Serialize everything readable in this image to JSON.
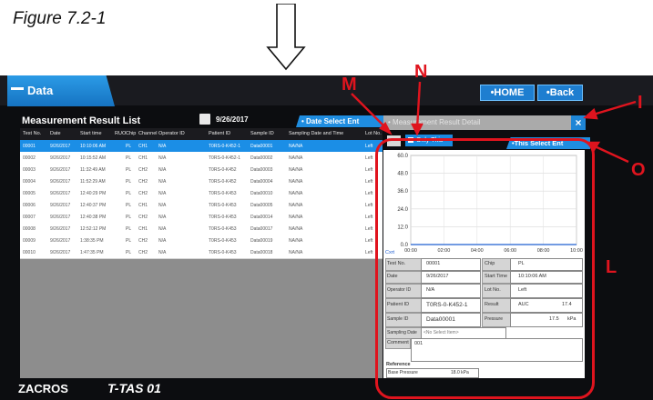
{
  "figure": {
    "caption": "Figure 7.2-1"
  },
  "callouts": {
    "m": "M",
    "n": "N",
    "i": "I",
    "o": "O",
    "l": "L"
  },
  "header": {
    "tab": "Data",
    "home": "•HOME",
    "back": "•Back"
  },
  "list": {
    "title": "Measurement Result List",
    "date": "9/26/2017",
    "date_select": "• Date Select Ent",
    "columns": [
      "Test No.",
      "Date",
      "Start time",
      "RUO",
      "Chip",
      "Channel",
      "Operator ID",
      "Patient ID",
      "Sample ID",
      "Sampling Date and Time",
      "Lot No."
    ],
    "rows": [
      [
        "00001",
        "9/26/2017",
        "10:10:06 AM",
        "",
        "PL",
        "CH1",
        "N/A",
        "T0RS-0-K452-1",
        "Data00001",
        "NA/NA",
        "Left"
      ],
      [
        "00002",
        "9/26/2017",
        "10:15:52 AM",
        "",
        "PL",
        "CH1",
        "N/A",
        "T0RS-0-K452-1",
        "Data00002",
        "NA/NA",
        "Left"
      ],
      [
        "00003",
        "9/26/2017",
        "11:32:49 AM",
        "",
        "PL",
        "CH2",
        "N/A",
        "T0RS-0-K452",
        "Data00003",
        "NA/NA",
        "Left"
      ],
      [
        "00004",
        "9/26/2017",
        "11:52:29 AM",
        "",
        "PL",
        "CH2",
        "N/A",
        "T0RS-0-K452",
        "Data00004",
        "NA/NA",
        "Left"
      ],
      [
        "00005",
        "9/26/2017",
        "12:40:29 PM",
        "",
        "PL",
        "CH2",
        "N/A",
        "T0RS-0-K453",
        "Data00010",
        "NA/NA",
        "Left"
      ],
      [
        "00006",
        "9/26/2017",
        "12:40:37 PM",
        "",
        "PL",
        "CH1",
        "N/A",
        "T0RS-0-K453",
        "Data00005",
        "NA/NA",
        "Left"
      ],
      [
        "00007",
        "9/26/2017",
        "12:40:38 PM",
        "",
        "PL",
        "CH2",
        "N/A",
        "T0RS-0-K453",
        "Data00014",
        "NA/NA",
        "Left"
      ],
      [
        "00008",
        "9/26/2017",
        "12:52:12 PM",
        "",
        "PL",
        "CH1",
        "N/A",
        "T0RS-0-K453",
        "Data00017",
        "NA/NA",
        "Left"
      ],
      [
        "00009",
        "9/26/2017",
        "1:38:35 PM",
        "",
        "PL",
        "CH2",
        "N/A",
        "T0RS-0-K453",
        "Data00019",
        "NA/NA",
        "Left"
      ],
      [
        "00010",
        "9/26/2017",
        "1:47:35 PM",
        "",
        "PL",
        "CH2",
        "N/A",
        "T0RS-0-K453",
        "Data00018",
        "NA/NA",
        "Left"
      ]
    ]
  },
  "detail": {
    "title": "• Measurement Result Detail",
    "close": "×",
    "only_this": "Only This",
    "this_select": "•This Select Ent",
    "chart_data": {
      "type": "line",
      "title": "",
      "xlabel": "",
      "ylabel": "",
      "y_ticks": [
        "60.0",
        "48.0",
        "36.0",
        "24.0",
        "12.0",
        "0.0"
      ],
      "x_ticks": [
        "00:00",
        "02:00",
        "04:00",
        "06:00",
        "08:00",
        "10:00"
      ],
      "ylim": [
        0,
        60
      ],
      "grid": true,
      "x": [
        0,
        0.2,
        0.5,
        1,
        2,
        4,
        6,
        8,
        10
      ],
      "values": [
        0,
        0,
        0,
        0,
        0,
        0,
        0,
        0,
        0
      ]
    },
    "corner_label": "Cxrt",
    "fields": {
      "test_no_label": "Test No.",
      "test_no": "00001",
      "chip_label": "Chip",
      "chip": "PL",
      "date_label": "Date",
      "date": "9/26/2017",
      "start_time_label": "Start Time",
      "start_time": "10:10:06 AM",
      "operator_label": "Operator ID",
      "operator": "N/A",
      "lot_label": "Lot No.",
      "lot": "Left",
      "patient_label": "Patient ID",
      "patient": "T0RS-0-K452-1",
      "result_label": "Result",
      "result_name": "AUC",
      "result_value": "17.4",
      "sample_label": "Sample ID",
      "sample": "Data00001",
      "pressure_label": "Pressure",
      "pressure": "17.5",
      "pressure_unit": "kPa",
      "sampling_label": "Sampling Date",
      "sampling_placeholder": "<No Select Item>",
      "comment_label": "Comment",
      "comment": "001",
      "reference_label": "Reference",
      "base_pressure_label": "Base Pressure",
      "base_pressure": "18.0 kPa"
    }
  },
  "footer": {
    "logo": "ZACROS",
    "logo2": "T-TAS 01"
  },
  "colors": {
    "accent": "#1f8de0",
    "callout": "#e0141e",
    "highlight_row": "#1b8ee6"
  }
}
